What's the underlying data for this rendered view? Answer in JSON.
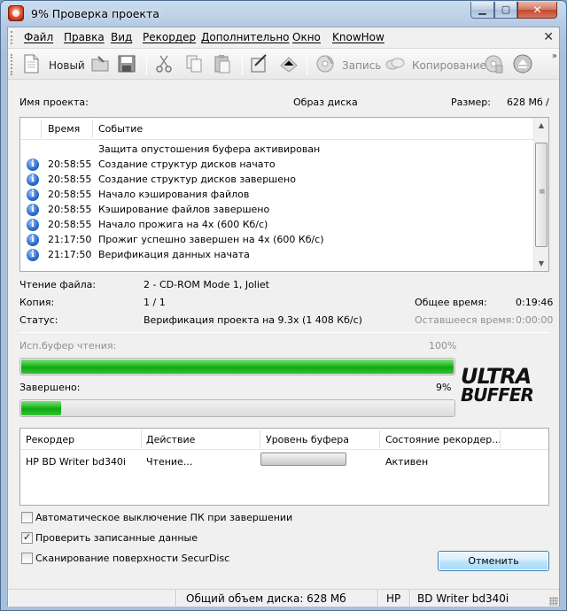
{
  "window": {
    "title": "9% Проверка проекта",
    "min_glyph": "▁",
    "max_glyph": "▢",
    "close_glyph": "✕"
  },
  "menu": {
    "items": [
      "Файл",
      "Правка",
      "Вид",
      "Рекордер",
      "Дополнительно",
      "Окно",
      "KnowHow"
    ],
    "close_glyph": "✕"
  },
  "toolbar": {
    "new_label": "Новый",
    "burn_label": "Запись",
    "copy_label": "Копирование",
    "more_glyph": "»"
  },
  "project": {
    "name_label": "Имя проекта:",
    "name_value": "Образ диска",
    "size_label": "Размер:",
    "size_value": "628 Мб",
    "size_sep": "/"
  },
  "log": {
    "col_time": "Время",
    "col_event": "Событие",
    "rows": [
      {
        "icon": false,
        "time": "",
        "msg": "Защита опустошения буфера активирован"
      },
      {
        "icon": true,
        "time": "20:58:55",
        "msg": "Создание структур дисков начато"
      },
      {
        "icon": true,
        "time": "20:58:55",
        "msg": "Создание структур дисков завершено"
      },
      {
        "icon": true,
        "time": "20:58:55",
        "msg": "Начало кэширования файлов"
      },
      {
        "icon": true,
        "time": "20:58:55",
        "msg": "Кэширование файлов завершено"
      },
      {
        "icon": true,
        "time": "20:58:55",
        "msg": "Начало прожига на 4x (600 Кб/с)"
      },
      {
        "icon": true,
        "time": "21:17:50",
        "msg": "Прожиг успешно завершен на 4x (600 Кб/с)"
      },
      {
        "icon": true,
        "time": "21:17:50",
        "msg": "Верификация данных начата"
      }
    ]
  },
  "info": {
    "read_file_label": "Чтение файла:",
    "read_file_value": "2 - CD-ROM Mode 1, Joliet",
    "copy_label": "Копия:",
    "copy_value": "1 / 1",
    "total_time_label": "Общее время:",
    "total_time_value": "0:19:46",
    "status_label": "Статус:",
    "status_value": "Верификация проекта на 9.3x (1 408 Кб/с)",
    "remaining_label": "Оставшееся время:",
    "remaining_value": "0:00:00"
  },
  "progress": {
    "buffer_label": "Исп.буфер чтения:",
    "buffer_percent_text": "100%",
    "buffer_fraction": 1.0,
    "done_label": "Завершено:",
    "done_percent_text": "9%",
    "done_fraction": 0.09
  },
  "logo": {
    "line1": "ULTRA",
    "line2": "BUFFER"
  },
  "recorder_table": {
    "headers": [
      "Рекордер",
      "Действие",
      "Уровень буфера",
      "Состояние рекордер..."
    ],
    "row": {
      "recorder": "HP BD Writer bd340i",
      "action": "Чтение...",
      "buffer_fraction": 0.0,
      "state": "Активен"
    }
  },
  "options": {
    "auto_shutdown": {
      "label": "Автоматическое выключение ПК при завершении",
      "checked": false
    },
    "verify": {
      "label": "Проверить записанные данные",
      "checked": true
    },
    "securdisc": {
      "label": "Сканирование поверхности SecurDisc",
      "checked": false
    }
  },
  "cancel_label": "Отменить",
  "statusbar": {
    "total": "Общий объем диска: 628 Мб",
    "vendor": "HP",
    "model": "BD Writer bd340i"
  },
  "colors": {
    "progress_green": "#0fa90f",
    "accent_blue": "#3c7fb1"
  }
}
